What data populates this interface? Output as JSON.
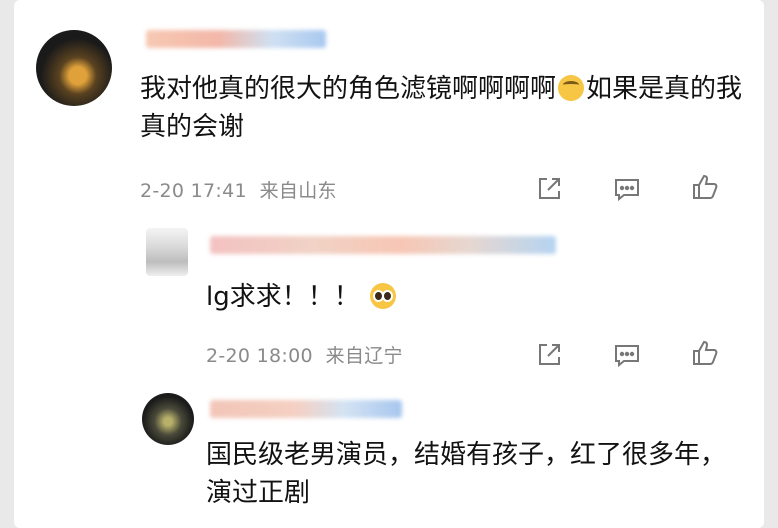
{
  "comments": [
    {
      "text_before_emoji": "我对他真的很大的角色滤镜啊啊啊啊",
      "emoji": "rolling-eyes-emoji",
      "text_after_emoji": "如果是真的我真的会谢",
      "time": "2-20 17:41",
      "location": "来自山东"
    },
    {
      "text": "lg求求！！！",
      "emoji": "pleading-face-emoji",
      "time": "2-20 18:00",
      "location": "来自辽宁"
    },
    {
      "text": "国民级老男演员，结婚有孩子，红了很多年，演过正剧"
    }
  ],
  "icons": {
    "share": "share-icon",
    "comment": "comment-icon",
    "like": "thumbs-up-icon"
  },
  "colors": {
    "meta_text": "#8a8a8a",
    "icon_stroke": "#777777"
  }
}
